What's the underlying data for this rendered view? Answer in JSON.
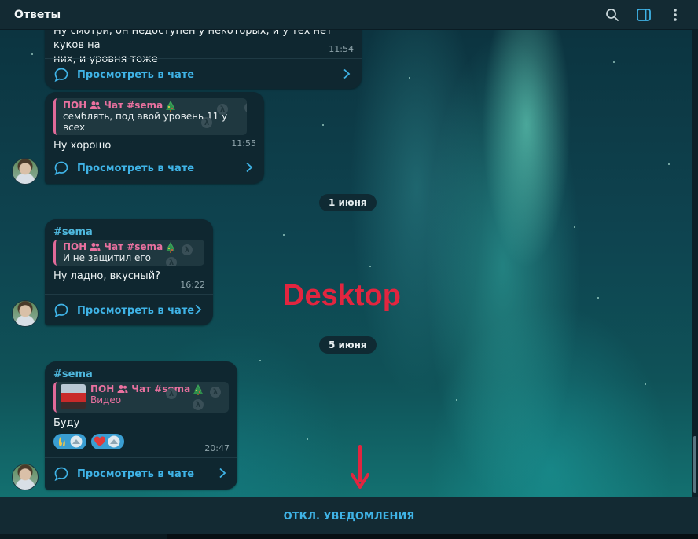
{
  "header": {
    "title": "Ответы",
    "icons": [
      "search-icon",
      "sidebar-toggle-icon",
      "more-vertical-icon"
    ]
  },
  "colors": {
    "accent": "#3fb3e6",
    "reply_name": "#e9719f",
    "watermark": "#e2253f"
  },
  "messages": [
    {
      "text_line1": "Ну смотри, он недоступен у некоторых, и у тех нет куков на",
      "text_line2": "них,  и уровня тоже",
      "time": "11:54",
      "view_label": "Просмотреть в чате"
    },
    {
      "reply": {
        "name": "ПОН",
        "chat": "Чат #sema",
        "text": "семблять, под авой уровень 11 у всех"
      },
      "text": "Ну хорошо",
      "time": "11:55",
      "view_label": "Просмотреть в чате"
    },
    {
      "hashtag": "#sema",
      "reply": {
        "name": "ПОН",
        "chat": "Чат #sema",
        "text": "И не защитил его"
      },
      "text": "Ну ладно, вкусный?",
      "time": "16:22",
      "view_label": "Просмотреть в чате"
    },
    {
      "hashtag": "#sema",
      "reply": {
        "name": "ПОН",
        "chat": "Чат #sema",
        "text": "Видео"
      },
      "text": "Буду",
      "time": "20:47",
      "view_label": "Просмотреть в чате"
    }
  ],
  "dates": [
    "1 июня",
    "5 июня"
  ],
  "watermark": "Desktop",
  "footer": {
    "mute_label": "ОТКЛ. УВЕДОМЛЕНИЯ"
  }
}
